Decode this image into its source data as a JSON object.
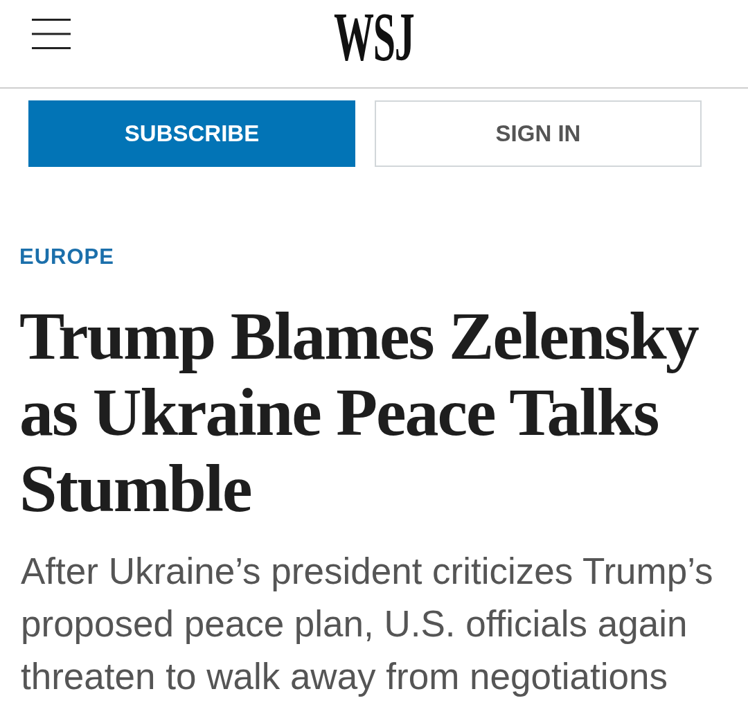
{
  "header": {
    "logo": "WSJ"
  },
  "buttons": [
    {
      "label": "SUBSCRIBE",
      "kind": "primary"
    },
    {
      "label": "SIGN IN",
      "kind": "secondary"
    }
  ],
  "article": {
    "section": "EUROPE",
    "headline": "Trump Blames Zelensky as Ukraine Peace Talks Stumble",
    "dek": "After Ukraine’s president criticizes Trump’s proposed peace plan, U.S. officials again threaten to walk away from negotiations"
  }
}
